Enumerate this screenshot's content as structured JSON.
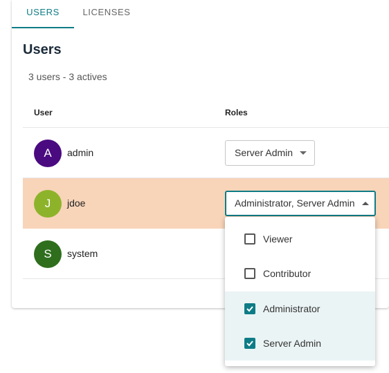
{
  "tabs": [
    {
      "label": "USERS",
      "active": true
    },
    {
      "label": "LICENSES",
      "active": false
    }
  ],
  "page": {
    "title": "Users",
    "summary": "3 users - 3 actives"
  },
  "table": {
    "headers": {
      "user": "User",
      "roles": "Roles"
    },
    "rows": [
      {
        "initial": "A",
        "name": "admin",
        "avatar_color": "#4a0a80",
        "roles": "Server Admin"
      },
      {
        "initial": "J",
        "name": "jdoe",
        "avatar_color": "#8db32b",
        "roles": "Administrator, Server Admin"
      },
      {
        "initial": "S",
        "name": "system",
        "avatar_color": "#2f6e1d"
      }
    ]
  },
  "dropdown": {
    "options": [
      {
        "label": "Viewer",
        "checked": false
      },
      {
        "label": "Contributor",
        "checked": false
      },
      {
        "label": "Administrator",
        "checked": true
      },
      {
        "label": "Server Admin",
        "checked": true
      }
    ]
  },
  "colors": {
    "accent": "#0e7c86",
    "selected_row": "#f8d4b9",
    "checked_option_bg": "#ebf4f5"
  },
  "icons": {
    "select_caret_closed": "caret-down-icon",
    "select_caret_open": "caret-up-icon",
    "checkbox_checked": "check-icon"
  }
}
